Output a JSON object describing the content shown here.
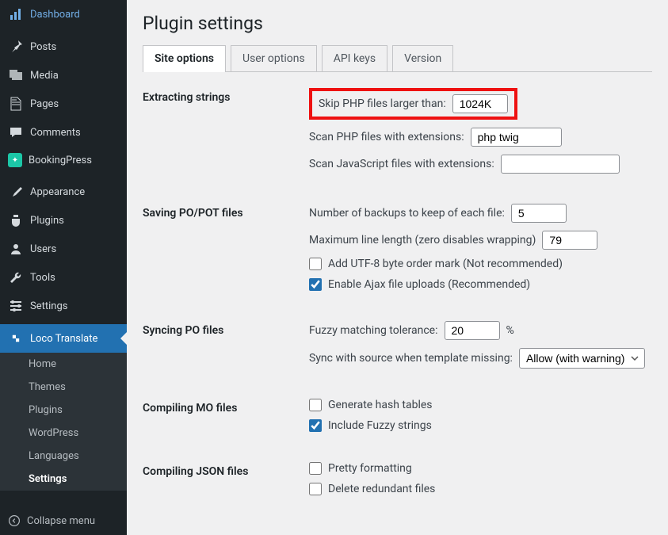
{
  "sidebar": {
    "items": [
      {
        "label": "Dashboard",
        "icon": "dashboard"
      },
      {
        "label": "Posts",
        "icon": "pin"
      },
      {
        "label": "Media",
        "icon": "media"
      },
      {
        "label": "Pages",
        "icon": "pages"
      },
      {
        "label": "Comments",
        "icon": "comment"
      },
      {
        "label": "BookingPress",
        "icon": "bp"
      },
      {
        "label": "Appearance",
        "icon": "brush"
      },
      {
        "label": "Plugins",
        "icon": "plug"
      },
      {
        "label": "Users",
        "icon": "user"
      },
      {
        "label": "Tools",
        "icon": "wrench"
      },
      {
        "label": "Settings",
        "icon": "sliders"
      },
      {
        "label": "Loco Translate",
        "icon": "lt"
      }
    ],
    "submenu": [
      "Home",
      "Themes",
      "Plugins",
      "WordPress",
      "Languages",
      "Settings"
    ],
    "collapse": "Collapse menu"
  },
  "page": {
    "title": "Plugin settings"
  },
  "tabs": [
    "Site options",
    "User options",
    "API keys",
    "Version"
  ],
  "sections": {
    "s0": {
      "title": "Extracting strings",
      "skipPhpLabel": "Skip PHP files larger than:",
      "skipPhpValue": "1024K",
      "scanPhpLabel": "Scan PHP files with extensions:",
      "scanPhpValue": "php twig",
      "scanJsLabel": "Scan JavaScript files with extensions:",
      "scanJsValue": ""
    },
    "s1": {
      "title": "Saving PO/POT files",
      "backupsLabel": "Number of backups to keep of each file:",
      "backupsValue": "5",
      "lineLenLabel": "Maximum line length (zero disables wrapping)",
      "lineLenValue": "79",
      "bomLabel": "Add UTF-8 byte order mark (Not recommended)",
      "ajaxLabel": "Enable Ajax file uploads (Recommended)"
    },
    "s2": {
      "title": "Syncing PO files",
      "fuzzyLabel": "Fuzzy matching tolerance:",
      "fuzzyValue": "20",
      "fuzzySuffix": "%",
      "syncLabel": "Sync with source when template missing:",
      "syncValue": "Allow (with warning)"
    },
    "s3": {
      "title": "Compiling MO files",
      "hashLabel": "Generate hash tables",
      "fuzzyStrLabel": "Include Fuzzy strings"
    },
    "s4": {
      "title": "Compiling JSON files",
      "prettyLabel": "Pretty formatting",
      "deleteLabel": "Delete redundant files"
    }
  }
}
